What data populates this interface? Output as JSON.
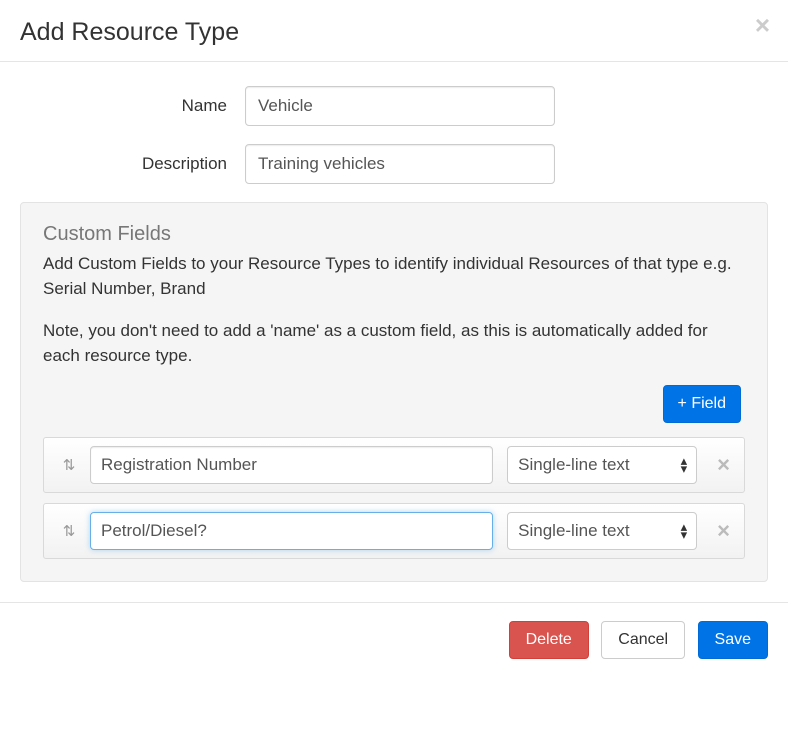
{
  "header": {
    "title": "Add Resource Type"
  },
  "form": {
    "name_label": "Name",
    "name_value": "Vehicle",
    "description_label": "Description",
    "description_value": "Training vehicles"
  },
  "custom_fields": {
    "title": "Custom Fields",
    "description": "Add Custom Fields to your Resource Types to identify individual Resources of that type e.g. Serial Number, Brand",
    "note": "Note, you don't need to add a 'name' as a custom field, as this is automatically added for each resource type.",
    "add_field_label": "+ Field",
    "fields": [
      {
        "name": "Registration Number",
        "type": "Single-line text"
      },
      {
        "name": "Petrol/Diesel?",
        "type": "Single-line text"
      }
    ]
  },
  "footer": {
    "delete_label": "Delete",
    "cancel_label": "Cancel",
    "save_label": "Save"
  }
}
